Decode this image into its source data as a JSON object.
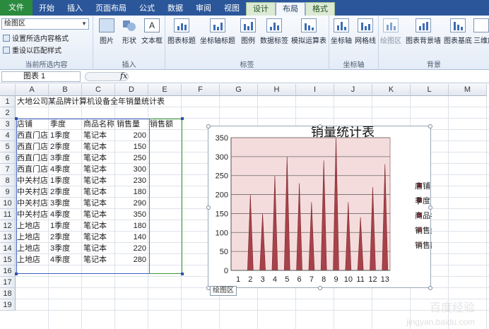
{
  "tabs": [
    {
      "label": "文件",
      "kind": "file"
    },
    {
      "label": "开始",
      "kind": "normal"
    },
    {
      "label": "插入",
      "kind": "normal"
    },
    {
      "label": "页面布局",
      "kind": "normal"
    },
    {
      "label": "公式",
      "kind": "normal"
    },
    {
      "label": "数据",
      "kind": "normal"
    },
    {
      "label": "审阅",
      "kind": "normal"
    },
    {
      "label": "视图",
      "kind": "normal"
    },
    {
      "label": "设计",
      "kind": "ctx"
    },
    {
      "label": "布局",
      "kind": "active"
    },
    {
      "label": "格式",
      "kind": "ctx"
    }
  ],
  "ribbon": {
    "selection_dropdown": "绘图区",
    "format_selection": "设置所选内容格式",
    "reset_style": "重设以匹配样式",
    "group_current": "当前所选内容",
    "insert": {
      "picture": "图片",
      "shapes": "形状",
      "textbox": "文本框",
      "group": "插入"
    },
    "labels": {
      "chart_title": "图表标题",
      "axis_titles": "坐标轴标题",
      "legend": "图例",
      "data_labels": "数据标签",
      "data_table": "模拟运算表",
      "group": "标签"
    },
    "axes": {
      "axes": "坐标轴",
      "gridlines": "网格线",
      "group": "坐标轴"
    },
    "background": {
      "plot_area": "绘图区",
      "chart_wall": "图表背景墙",
      "chart_floor": "图表基底",
      "rotation": "三维旋",
      "group": "背景"
    }
  },
  "formula_bar": {
    "name_box": "图表 1",
    "fx": "fx"
  },
  "columns": [
    "A",
    "B",
    "C",
    "D",
    "E",
    "F",
    "G",
    "H",
    "I",
    "J",
    "K",
    "L",
    "M"
  ],
  "rows": [
    "1",
    "2",
    "3",
    "4",
    "5",
    "6",
    "7",
    "8",
    "9",
    "10",
    "11",
    "12",
    "13",
    "14",
    "15",
    "16",
    "17",
    "18",
    "19"
  ],
  "sheet": {
    "title": "大地公司某品牌计算机设备全年销量统计表",
    "headers": [
      "店铺",
      "季度",
      "商品名称",
      "销售量",
      "销售额"
    ],
    "data": [
      [
        "西直门店",
        "1季度",
        "笔记本",
        "200"
      ],
      [
        "西直门店",
        "2季度",
        "笔记本",
        "150"
      ],
      [
        "西直门店",
        "3季度",
        "笔记本",
        "250"
      ],
      [
        "西直门店",
        "4季度",
        "笔记本",
        "300"
      ],
      [
        "中关村店",
        "1季度",
        "笔记本",
        "230"
      ],
      [
        "中关村店",
        "2季度",
        "笔记本",
        "180"
      ],
      [
        "中关村店",
        "3季度",
        "笔记本",
        "290"
      ],
      [
        "中关村店",
        "4季度",
        "笔记本",
        "350"
      ],
      [
        "上地店",
        "1季度",
        "笔记本",
        "180"
      ],
      [
        "上地店",
        "2季度",
        "笔记本",
        "140"
      ],
      [
        "上地店",
        "3季度",
        "笔记本",
        "220"
      ],
      [
        "上地店",
        "4季度",
        "笔记本",
        "280"
      ]
    ]
  },
  "chart_tooltip": "绘图区",
  "watermark": "百度经验",
  "watermark_url": "jingyan.baidu.com",
  "colors": {
    "accent": "#2b579a",
    "plot_bg": "#f5dcdc",
    "series": "#a8424a"
  },
  "chart_data": {
    "type": "area",
    "title": "销量统计表",
    "categories": [
      1,
      2,
      3,
      4,
      5,
      6,
      7,
      8,
      9,
      10,
      11,
      12,
      13
    ],
    "series": [
      {
        "name": "销售量",
        "values": [
          0,
          200,
          150,
          250,
          300,
          230,
          180,
          290,
          350,
          180,
          140,
          220,
          280
        ]
      }
    ],
    "legend": [
      "店铺",
      "季度",
      "商品名称",
      "销售量",
      "销售额"
    ],
    "legend_placement": "right",
    "ylim": [
      0,
      350
    ],
    "yticks": [
      0,
      50,
      100,
      150,
      200,
      250,
      300,
      350
    ],
    "grid": true
  }
}
